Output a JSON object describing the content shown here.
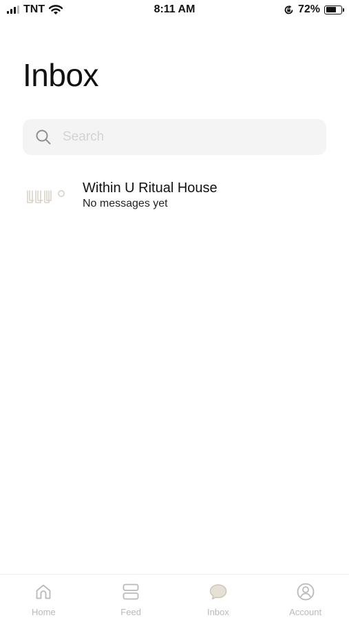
{
  "status_bar": {
    "carrier": "TNT",
    "time": "8:11 AM",
    "battery_percent": "72%",
    "battery_level": 0.72,
    "icons": [
      "signal-icon",
      "wifi-icon",
      "rotation-lock-icon",
      "battery-icon"
    ]
  },
  "header": {
    "title": "Inbox"
  },
  "search": {
    "placeholder": "Search",
    "value": "",
    "icon": "search-icon"
  },
  "conversations": [
    {
      "name": "Within U Ritual House",
      "preview": "No messages yet",
      "avatar": "within-u-logo"
    }
  ],
  "tab_bar": {
    "active": "Inbox",
    "active_color": "#d8d2c6",
    "inactive_color": "#b9b9b9",
    "tabs": [
      {
        "label": "Home",
        "icon": "home-icon"
      },
      {
        "label": "Feed",
        "icon": "feed-icon"
      },
      {
        "label": "Inbox",
        "icon": "chat-bubble-icon"
      },
      {
        "label": "Account",
        "icon": "account-icon"
      }
    ]
  }
}
